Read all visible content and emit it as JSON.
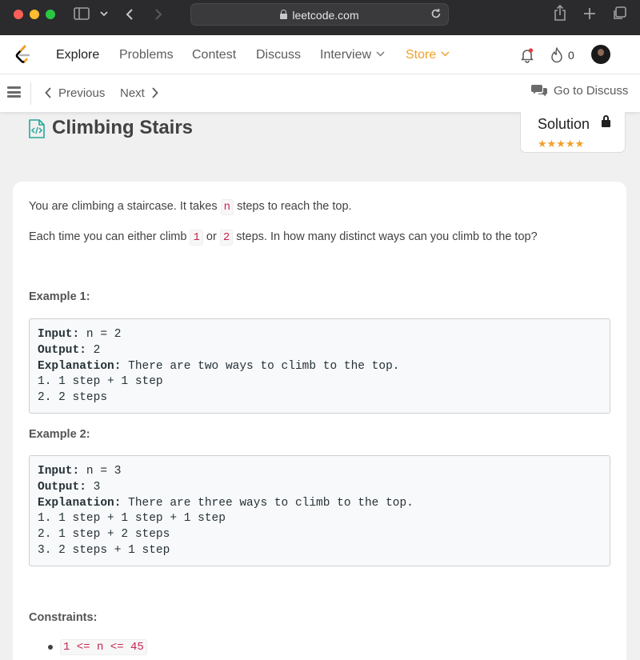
{
  "browser": {
    "url": "leetcode.com"
  },
  "nav": {
    "items": [
      "Explore",
      "Problems",
      "Contest",
      "Discuss",
      "Interview",
      "Store"
    ],
    "streak_count": "0"
  },
  "subbar": {
    "previous": "Previous",
    "next": "Next",
    "go_to_discuss": "Go to Discuss"
  },
  "problem": {
    "title": "Climbing Stairs",
    "solution_label": "Solution",
    "rating_stars": "★★★★★",
    "desc1_pre": "You are climbing a staircase. It takes ",
    "desc1_code": "n",
    "desc1_post": " steps to reach the top.",
    "desc2_pre": "Each time you can either climb ",
    "desc2_code1": "1",
    "desc2_mid": " or ",
    "desc2_code2": "2",
    "desc2_post": " steps. In how many distinct ways can you climb to the top?",
    "example1_heading": "Example 1:",
    "example1": {
      "input_label": "Input:",
      "input": " n = 2",
      "output_label": "Output:",
      "output": " 2",
      "explanation_label": "Explanation:",
      "explanation": " There are two ways to climb to the top.",
      "line1": "1. 1 step + 1 step",
      "line2": "2. 2 steps"
    },
    "example2_heading": "Example 2:",
    "example2": {
      "input_label": "Input:",
      "input": " n = 3",
      "output_label": "Output:",
      "output": " 3",
      "explanation_label": "Explanation:",
      "explanation": " There are three ways to climb to the top.",
      "line1": "1. 1 step + 1 step + 1 step",
      "line2": "2. 1 step + 2 steps",
      "line3": "3. 2 steps + 1 step"
    },
    "constraints_heading": "Constraints:",
    "constraint1": "1 <= n <= 45"
  },
  "colors": {
    "accent_store": "#f0a12b",
    "code_red": "#c7254e",
    "chrome_bg": "#2b2b2d"
  }
}
